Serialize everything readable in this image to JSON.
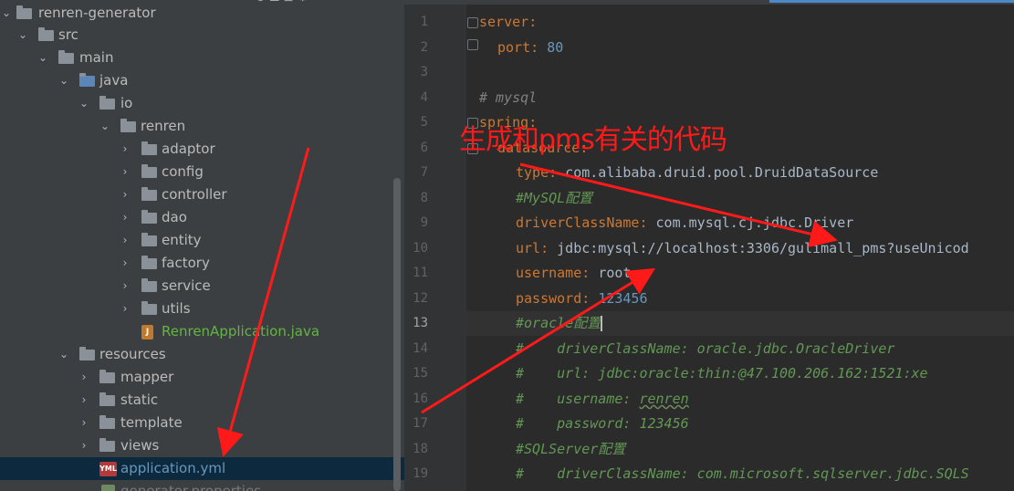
{
  "project_tree": {
    "root": "renren-generator",
    "src": "src",
    "main": "main",
    "java": "java",
    "io": "io",
    "renren": "renren",
    "packages": [
      "adaptor",
      "config",
      "controller",
      "dao",
      "entity",
      "factory",
      "service",
      "utils"
    ],
    "app_class": "RenrenApplication.java",
    "resources": "resources",
    "resource_folders": [
      "mapper",
      "static",
      "template",
      "views"
    ],
    "selected_file": "application.yml",
    "next_file": "generator.properties",
    "java_badge": "J",
    "yml_badge": "YML"
  },
  "editor": {
    "line_numbers": [
      "1",
      "2",
      "3",
      "4",
      "5",
      "6",
      "7",
      "8",
      "9",
      "10",
      "11",
      "12",
      "13",
      "14",
      "15",
      "16",
      "17",
      "18",
      "19"
    ],
    "current_line": "13",
    "lines": {
      "l1_key": "server",
      "l2_key": "port",
      "l2_val": "80",
      "l4_comment": "# mysql",
      "l5_key": "spring",
      "l6_key": "datasource",
      "l7_key": "type",
      "l7_val": "com.alibaba.druid.pool.DruidDataSource",
      "l8_comment": "#MySQL配置",
      "l9_key": "driverClassName",
      "l9_val": "com.mysql.cj.jdbc.Driver",
      "l10_key": "url",
      "l10_val": "jdbc:mysql://localhost:3306/gulimall_pms?useUnicod",
      "l11_key": "username",
      "l11_val": "root",
      "l12_key": "password",
      "l12_val": "123456",
      "l13_comment": "#oracle配置",
      "l14_comment": "#    driverClassName: oracle.jdbc.OracleDriver",
      "l15_comment": "#    url: jdbc:oracle:thin:@47.100.206.162:1521:xe",
      "l16_hash": "#    username: ",
      "l16_val": "renren",
      "l17_comment": "#    password: 123456",
      "l18_comment": "#SQLServer配置",
      "l19_comment": "#    driverClassName: com.microsoft.sqlserver.jdbc.SQLS"
    },
    "colon": ":"
  },
  "annotation": {
    "text": "生成和pms有关的代码",
    "color": "#ff1a1a"
  },
  "colors": {
    "tree_bg": "#3c3f41",
    "editor_bg": "#2b2b2b",
    "keyword": "#cc7832",
    "number": "#6897bb",
    "comment": "#629755"
  }
}
